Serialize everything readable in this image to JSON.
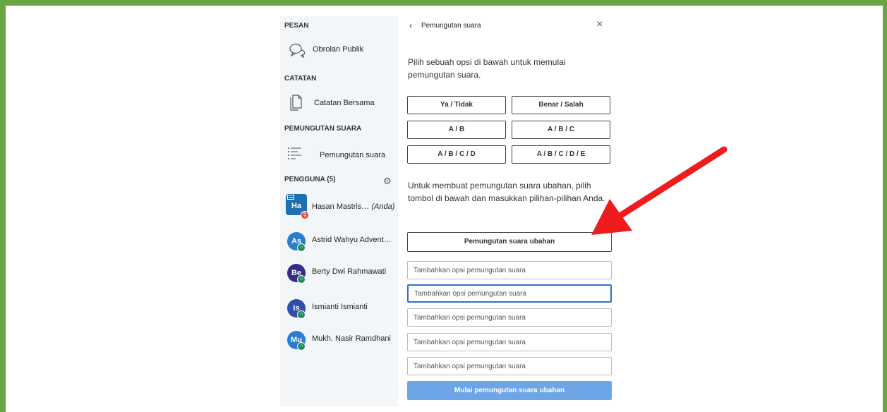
{
  "sidebar": {
    "messages_title": "PESAN",
    "public_chat": "Obrolan Publik",
    "notes_title": "CATATAN",
    "shared_notes": "Catatan Bersama",
    "polling_title": "PEMUNGUTAN SUARA",
    "polling_item": "Pemungutan suara",
    "users_title": "PENGGUNA (5)",
    "users": [
      {
        "initials": "Ha",
        "name": "Hasan Mastris…",
        "suffix": "(Anda)",
        "color": "#1f6fb5",
        "badge_color": "#e0463c"
      },
      {
        "initials": "As",
        "name": "Astrid Wahyu Advent…",
        "suffix": "",
        "color": "#2a7dd1",
        "badge_color": "#1b8a5a"
      },
      {
        "initials": "Be",
        "name": "Berty Dwi Rahmawati",
        "suffix": "",
        "color": "#3a2a8c",
        "badge_color": "#1b8a5a"
      },
      {
        "initials": "Is",
        "name": "Ismianti Ismianti",
        "suffix": "",
        "color": "#2f4fa8",
        "badge_color": "#1b8a5a"
      },
      {
        "initials": "Mu",
        "name": "Mukh. Nasir Ramdhani",
        "suffix": "",
        "color": "#2a7dd1",
        "badge_color": "#1b8a5a"
      }
    ]
  },
  "panel": {
    "back_icon": "‹",
    "title": "Pemungutan suara",
    "close_icon": "×",
    "intro": "Pilih sebuah opsi di bawah untuk memulai pemungutan suara.",
    "options": [
      "Ya / Tidak",
      "Benar / Salah",
      "A / B",
      "A / B / C",
      "A / B / C / D",
      "A / B / C / D / E"
    ],
    "custom_intro": "Untuk membuat pemungutan suara ubahan, pilih tombol di bawah dan masukkan pilihan-pilihan Anda.",
    "custom_button": "Pemungutan suara ubahan",
    "input_placeholder": "Tambahkan opsi pemungutan suara",
    "start_button": "Mulai pemungutan suara ubahan"
  },
  "colors": {
    "frame": "#6aa544",
    "arrow": "#ee1c1c",
    "accent": "#2a75c7",
    "start_button": "#6ea5e6"
  }
}
